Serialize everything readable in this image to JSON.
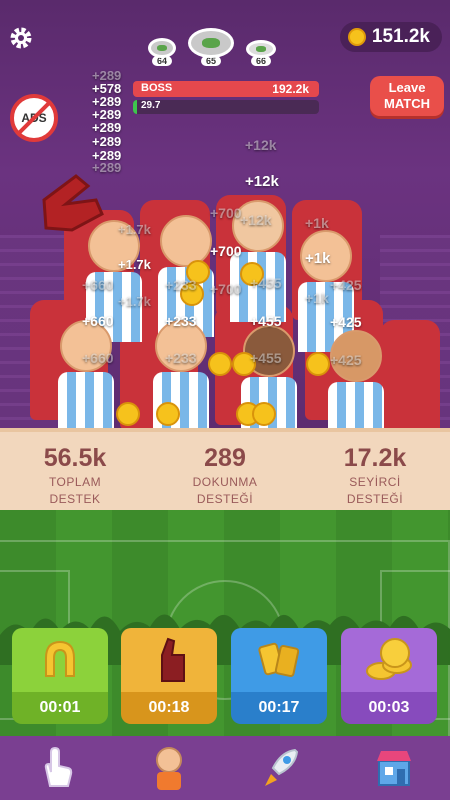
{
  "header": {
    "coins": "151.2k",
    "stadiums": [
      {
        "level": "64"
      },
      {
        "level": "65"
      },
      {
        "level": "66"
      }
    ],
    "leave_label_1": "Leave",
    "leave_label_2": "MATCH",
    "ads_label": "ADS"
  },
  "battle": {
    "boss_label": "BOSS",
    "boss_value": "192.2k",
    "my_value": "29.7",
    "my_fill_fraction": 0.02
  },
  "floating": {
    "tap_stack": [
      "+289",
      "+578",
      "+289",
      "+289",
      "+289",
      "+289",
      "+289",
      "+289"
    ],
    "crowd": [
      "+12k",
      "+12k",
      "+12k",
      "+1k",
      "+1k",
      "+1k",
      "+1.7k",
      "+1.7k",
      "+1.7k",
      "+700",
      "+700",
      "+700",
      "+660",
      "+660",
      "+660",
      "+455",
      "+455",
      "+455",
      "+425",
      "+425",
      "+425",
      "+233",
      "+233",
      "+233"
    ]
  },
  "stats": [
    {
      "value": "56.5k",
      "line1": "TOPLAM",
      "line2": "DESTEK"
    },
    {
      "value": "289",
      "line1": "DOKUNMA",
      "line2": "DESTEĞİ"
    },
    {
      "value": "17.2k",
      "line1": "SEYİRCİ",
      "line2": "DESTEĞİ"
    }
  ],
  "boosters": [
    {
      "name": "horseshoe",
      "time": "00:01",
      "top": "#8cd23b",
      "bottom": "#6fb227"
    },
    {
      "name": "foam-finger",
      "time": "00:18",
      "top": "#f0b43a",
      "bottom": "#d8951c"
    },
    {
      "name": "cards",
      "time": "00:17",
      "top": "#3f9be6",
      "bottom": "#2a7fcb"
    },
    {
      "name": "coin-pile",
      "time": "00:03",
      "top": "#a56ad8",
      "bottom": "#874bbd"
    }
  ],
  "nav": [
    "tap-icon",
    "fan-icon",
    "rocket-icon",
    "shop-icon"
  ]
}
